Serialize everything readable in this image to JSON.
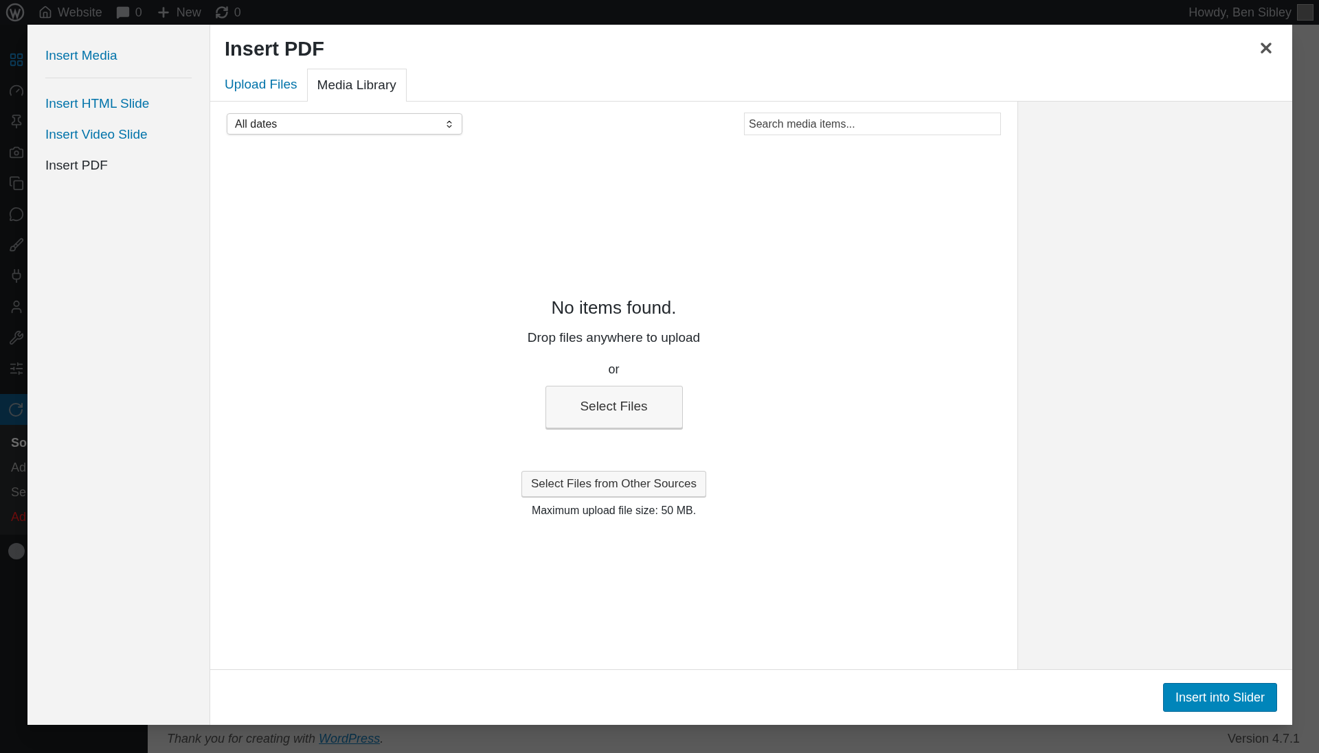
{
  "admin_bar": {
    "items": [
      {
        "kind": "logo"
      },
      {
        "kind": "home",
        "label": "Website"
      },
      {
        "kind": "comments",
        "label": "0"
      },
      {
        "kind": "new",
        "label": "New"
      },
      {
        "kind": "updates",
        "label": "0"
      }
    ],
    "greeting": "Howdy, Ben Sibley"
  },
  "admin_menu": {
    "submenu": [
      {
        "kind": "heading",
        "label": "So"
      },
      {
        "kind": "link",
        "label": "Ad"
      },
      {
        "kind": "link",
        "label": "Se"
      },
      {
        "kind": "alert",
        "label": "Ad"
      }
    ]
  },
  "modal": {
    "menu_groups": [
      {
        "items": [
          {
            "label": "Insert Media",
            "selected": false
          }
        ]
      },
      {
        "items": [
          {
            "label": "Insert HTML Slide",
            "selected": false
          },
          {
            "label": "Insert Video Slide",
            "selected": false
          },
          {
            "label": "Insert PDF",
            "selected": true
          }
        ]
      }
    ],
    "title": "Insert PDF",
    "tabs": [
      {
        "label": "Upload Files",
        "selected": false
      },
      {
        "label": "Media Library",
        "selected": true
      }
    ],
    "date_filter": "All dates",
    "search": {
      "placeholder": "Search media items..."
    },
    "empty": {
      "title": "No items found.",
      "hint": "Drop files anywhere to upload",
      "or": "or",
      "select_button": "Select Files",
      "other_sources_button": "Select Files from Other Sources",
      "max_size": "Maximum upload file size: 50 MB."
    },
    "primary_button": "Insert into Slider"
  },
  "footer": {
    "text_before": "Thank you for creating with ",
    "link": "WordPress",
    "text_after": ".",
    "version": "Version 4.7.1"
  }
}
